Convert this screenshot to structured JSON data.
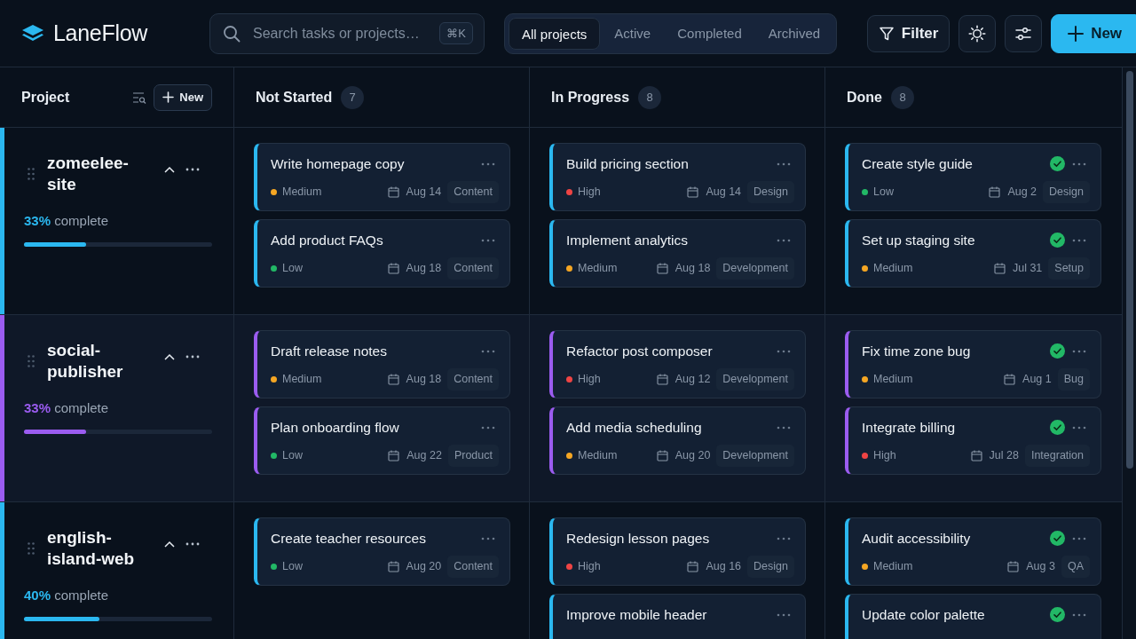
{
  "app": {
    "name": "LaneFlow"
  },
  "search": {
    "placeholder": "Search tasks or projects…",
    "shortcut": "⌘K"
  },
  "filter_tabs": [
    {
      "label": "All projects",
      "selected": true
    },
    {
      "label": "Active",
      "selected": false
    },
    {
      "label": "Completed",
      "selected": false
    },
    {
      "label": "Archived",
      "selected": false
    }
  ],
  "toolbar": {
    "filter": "Filter",
    "new": "New"
  },
  "board": {
    "project_header": "Project",
    "new_project": "New",
    "columns": [
      {
        "title": "Not Started",
        "count": "7"
      },
      {
        "title": "In Progress",
        "count": "8"
      },
      {
        "title": "Done",
        "count": "8"
      }
    ],
    "projects": [
      {
        "name": "zomeelee-site",
        "color": "#2bb8f0",
        "percent": "33%",
        "complete_label": "complete",
        "level": 0.33,
        "expanded": true,
        "lanes": [
          [
            {
              "title": "Write homepage copy",
              "done": false,
              "priority": {
                "label": "Medium",
                "color": "#f5a623"
              },
              "date": "Aug 14",
              "tag": "Content"
            },
            {
              "title": "Add product FAQs",
              "done": false,
              "priority": {
                "label": "Low",
                "color": "#22b866"
              },
              "date": "Aug 18",
              "tag": "Content"
            }
          ],
          [
            {
              "title": "Build pricing section",
              "done": false,
              "priority": {
                "label": "High",
                "color": "#ef4444"
              },
              "date": "Aug 14",
              "tag": "Design"
            },
            {
              "title": "Implement analytics",
              "done": false,
              "priority": {
                "label": "Medium",
                "color": "#f5a623"
              },
              "date": "Aug 18",
              "tag": "Development"
            }
          ],
          [
            {
              "title": "Create style guide",
              "done": true,
              "priority": {
                "label": "Low",
                "color": "#22b866"
              },
              "date": "Aug 2",
              "tag": "Design"
            },
            {
              "title": "Set up staging site",
              "done": true,
              "priority": {
                "label": "Medium",
                "color": "#f5a623"
              },
              "date": "Jul 31",
              "tag": "Setup"
            }
          ]
        ]
      },
      {
        "name": "social-publisher",
        "color": "#9b5cf0",
        "percent": "33%",
        "complete_label": "complete",
        "level": 0.33,
        "expanded": true,
        "lanes": [
          [
            {
              "title": "Draft release notes",
              "done": false,
              "priority": {
                "label": "Medium",
                "color": "#f5a623"
              },
              "date": "Aug 18",
              "tag": "Content"
            },
            {
              "title": "Plan onboarding flow",
              "done": false,
              "priority": {
                "label": "Low",
                "color": "#22b866"
              },
              "date": "Aug 22",
              "tag": "Product"
            }
          ],
          [
            {
              "title": "Refactor post composer",
              "done": false,
              "priority": {
                "label": "High",
                "color": "#ef4444"
              },
              "date": "Aug 12",
              "tag": "Development"
            },
            {
              "title": "Add media scheduling",
              "done": false,
              "priority": {
                "label": "Medium",
                "color": "#f5a623"
              },
              "date": "Aug 20",
              "tag": "Development"
            }
          ],
          [
            {
              "title": "Fix time zone bug",
              "done": true,
              "priority": {
                "label": "Medium",
                "color": "#f5a623"
              },
              "date": "Aug 1",
              "tag": "Bug"
            },
            {
              "title": "Integrate billing",
              "done": true,
              "priority": {
                "label": "High",
                "color": "#ef4444"
              },
              "date": "Jul 28",
              "tag": "Integration"
            }
          ]
        ]
      },
      {
        "name": "english-island-web",
        "color": "#2bb8f0",
        "percent": "40%",
        "complete_label": "complete",
        "level": 0.4,
        "expanded": true,
        "lanes": [
          [
            {
              "title": "Create teacher resources",
              "done": false,
              "priority": {
                "label": "Low",
                "color": "#22b866"
              },
              "date": "Aug 20",
              "tag": "Content"
            }
          ],
          [
            {
              "title": "Redesign lesson pages",
              "done": false,
              "priority": {
                "label": "High",
                "color": "#ef4444"
              },
              "date": "Aug 16",
              "tag": "Design"
            },
            {
              "title": "Improve mobile header",
              "done": false
            }
          ],
          [
            {
              "title": "Audit accessibility",
              "done": true,
              "priority": {
                "label": "Medium",
                "color": "#f5a623"
              },
              "date": "Aug 3",
              "tag": "QA"
            },
            {
              "title": "Update color palette",
              "done": true
            }
          ]
        ]
      }
    ]
  }
}
